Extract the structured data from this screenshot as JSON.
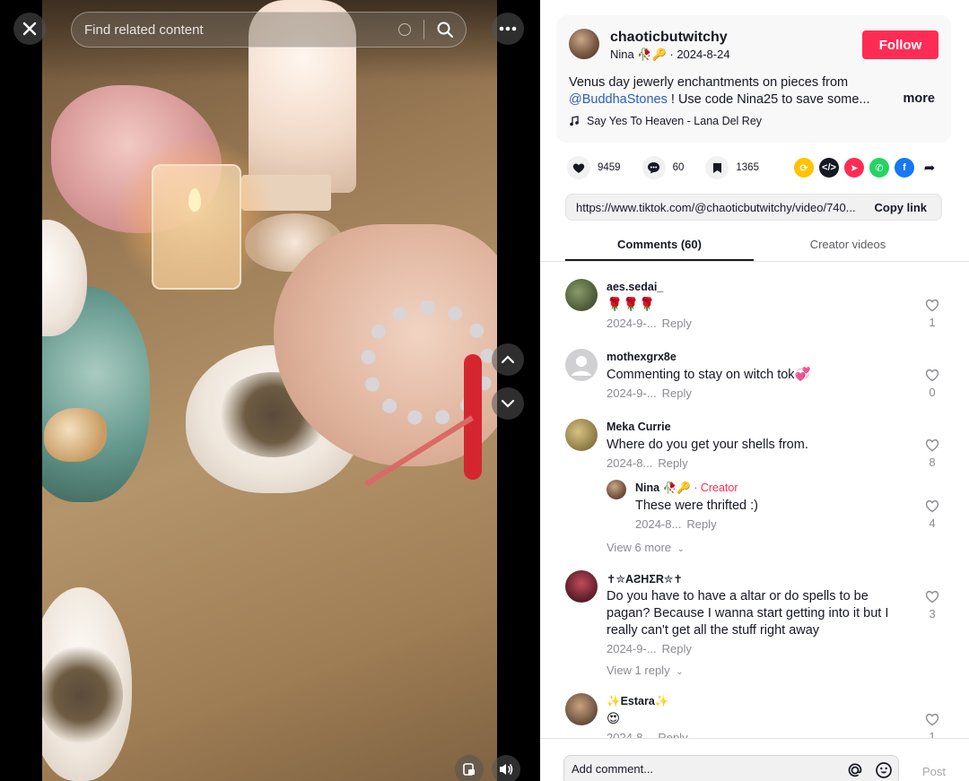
{
  "search": {
    "placeholder": "Find related content"
  },
  "post": {
    "author_username": "chaoticbutwitchy",
    "author_display": "Nina 🥀🔑",
    "date": "2024-8-24",
    "follow_label": "Follow",
    "description_pre": "Venus day jewerly enchantments on pieces from ",
    "description_mention": "@BuddhaStones",
    "description_post": " ! Use code Nina25 to save some...",
    "more_label": "more",
    "music": "Say Yes To Heaven - Lana Del Rey"
  },
  "actions": {
    "likes": "9459",
    "comments": "60",
    "saves": "1365"
  },
  "share_icons": [
    {
      "name": "repost-icon",
      "color": "#ffc300",
      "glyph": "⟳"
    },
    {
      "name": "embed-icon",
      "color": "#161823",
      "glyph": "</>"
    },
    {
      "name": "send-to-friend-icon",
      "color": "#fe2c55",
      "glyph": "➤"
    },
    {
      "name": "whatsapp-icon",
      "color": "#25d366",
      "glyph": "✆"
    },
    {
      "name": "facebook-icon",
      "color": "#1877f2",
      "glyph": "f"
    },
    {
      "name": "share-arrow-icon",
      "color": "#ffffff",
      "glyph": "➦"
    }
  ],
  "link": {
    "url": "https://www.tiktok.com/@chaoticbutwitchy/video/740...",
    "copy_label": "Copy link"
  },
  "tabs": {
    "comments": "Comments (60)",
    "creator": "Creator videos"
  },
  "comments": [
    {
      "user": "aes.sedai_",
      "text": "🌹🌹🌹",
      "date": "2024-9-...",
      "reply": "Reply",
      "likes": "1",
      "avatar_color": "#3b4d2a"
    },
    {
      "user": "mothexgrx8e",
      "text": "Commenting to stay on witch tok💞",
      "date": "2024-9-...",
      "reply": "Reply",
      "likes": "0",
      "avatar_color": "#d0d0d3"
    },
    {
      "user": "Meka Currie",
      "text": "Where do you get your shells from.",
      "date": "2024-8...",
      "reply": "Reply",
      "likes": "8",
      "avatar_color": "#8c7a4a",
      "replies": [
        {
          "user": "Nina 🥀🔑",
          "creator_tag": "· Creator",
          "text": "These were thrifted :)",
          "date": "2024-8...",
          "reply": "Reply",
          "likes": "4"
        }
      ],
      "view_more": "View 6 more"
    },
    {
      "user": "✝︎✮ΑƧHΣR✮✝︎",
      "text": "Do you have to have a altar or do spells to be pagan? Because I wanna start getting into it but I really can't get all the stuff right away",
      "date": "2024-9-...",
      "reply": "Reply",
      "likes": "3",
      "avatar_color": "#5a1a22",
      "view_more": "View 1 reply"
    },
    {
      "user": "✨Estara✨",
      "text": "😍",
      "date": "2024-8...",
      "reply": "Reply",
      "likes": "1",
      "avatar_color": "#6b5540"
    }
  ],
  "comment_bar": {
    "placeholder": "Add comment...",
    "post_label": "Post"
  }
}
